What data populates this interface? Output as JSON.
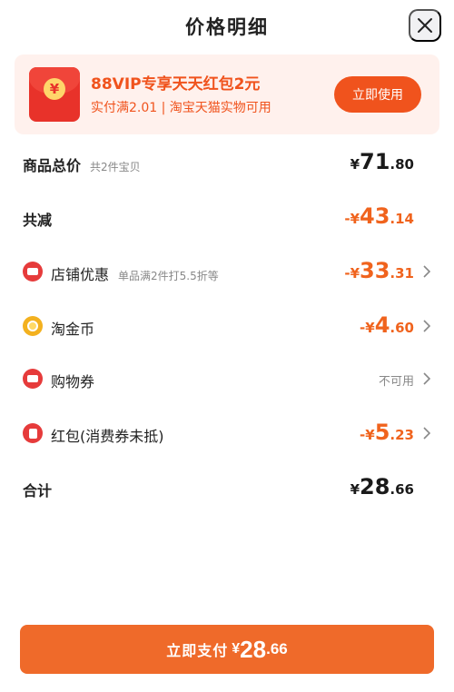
{
  "header": {
    "title": "价格明细"
  },
  "banner": {
    "coin_symbol": "¥",
    "title": "88VIP专享天天红包2元",
    "subtitle": "实付满2.01 | 淘宝天猫实物可用",
    "button_label": "立即使用"
  },
  "rows": {
    "total": {
      "label": "商品总价",
      "sub": "共2件宝贝",
      "currency": "¥",
      "int": "71",
      "dec": ".80"
    },
    "reduce": {
      "label": "共减",
      "currency": "-¥",
      "int": "43",
      "dec": ".14"
    },
    "shop": {
      "label": "店铺优惠",
      "sub": "单品满2件打5.5折等",
      "currency": "-¥",
      "int": "33",
      "dec": ".31"
    },
    "coin": {
      "label": "淘金币",
      "currency": "-¥",
      "int": "4",
      "dec": ".60"
    },
    "voucher": {
      "label": "购物券",
      "status": "不可用"
    },
    "redpacket": {
      "label": "红包(消费券未抵)",
      "currency": "-¥",
      "int": "5",
      "dec": ".23"
    },
    "sum": {
      "label": "合计",
      "currency": "¥",
      "int": "28",
      "dec": ".66"
    }
  },
  "pay": {
    "label": "立即支付",
    "currency": "¥",
    "int": "28",
    "dec": ".66"
  },
  "colors": {
    "accent": "#f0531d",
    "pay_button": "#ef6a2a",
    "banner_bg": "#fff1ed",
    "discount": "#f0631d"
  }
}
